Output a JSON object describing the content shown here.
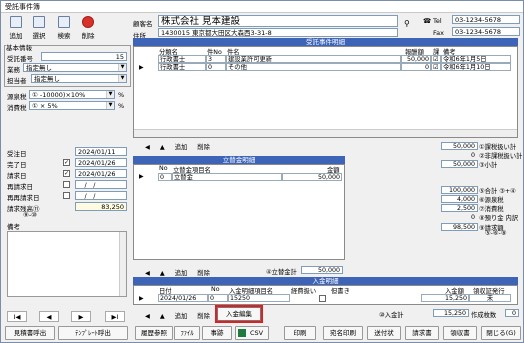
{
  "window": {
    "title": "受託事件簿"
  },
  "toolbar": [
    {
      "label": "追加",
      "icon": "add-icon"
    },
    {
      "label": "選択",
      "icon": "select-icon"
    },
    {
      "label": "検索",
      "icon": "search-icon"
    },
    {
      "label": "削除",
      "icon": "delete-icon"
    }
  ],
  "client": {
    "name_label": "顧客名",
    "name": "株式会社 見本建設",
    "address_label": "住所",
    "address": "1430015 東京都大田区大森西3-31-8",
    "tel_label": "Tel",
    "tel": "03-1234-5678",
    "fax_label": "Fax",
    "fax": "03-1234-5678"
  },
  "basic": {
    "title": "基本情報",
    "jutaku_no_label": "受託番号",
    "jutaku_no": "15",
    "gyomu_label": "業務",
    "gyomu": "指定無し",
    "tanto_label": "担当者",
    "tanto": "指定無し",
    "gensen_label": "源泉税",
    "gensen": "① -10000)×10%",
    "shohi_label": "消費税",
    "shohi": "① × 5%",
    "pct": "%"
  },
  "dates": {
    "juchu_label": "受注日",
    "juchu": "2024/01/11",
    "kanryo_label": "完了日",
    "kanryo": "2024/01/26",
    "seikyu_label": "請求日",
    "seikyu": "2024/01/26",
    "sai1_label": "再請求日",
    "sai1": "__/__/__",
    "sai2_label": "再再請求日",
    "sai2": "__/__/__",
    "zandaka_label": "請求残高⑪",
    "zandaka_sub": "⑨-⑩",
    "zandaka": "83,250",
    "biko_label": "備考"
  },
  "jutaku_detail": {
    "title": "受託事件明細",
    "headers": [
      "分類名",
      "件No",
      "件名",
      "報酬額",
      "課",
      "備考"
    ],
    "rows": [
      {
        "bunrui": "行政書士",
        "no": "3",
        "name": "建設業許可更新",
        "amount": "50,000",
        "kazei": "☑",
        "biko": "令和6年1月5日"
      },
      {
        "bunrui": "行政書士",
        "no": "0",
        "name": "その他",
        "amount": "0",
        "kazei": "☑",
        "biko": "令和6年1月10日"
      }
    ]
  },
  "tatekae": {
    "title": "立替金明細",
    "headers": [
      "No",
      "立替金項目名",
      "金額"
    ],
    "rows": [
      {
        "no": "0",
        "name": "立替金",
        "amount": "50,000"
      }
    ],
    "total_label": "④立替金計",
    "total": "50,000"
  },
  "nyukin": {
    "title": "入金明細",
    "headers": [
      "日付",
      "No",
      "入金明細項目名",
      "経費扱い",
      "但書き",
      "入金額",
      "領収証発行"
    ],
    "rows": [
      {
        "date": "2024/01/26",
        "no": "0",
        "name": "15250",
        "amount": "15,250",
        "receipt": "未"
      }
    ],
    "total_label": "⑩入金計",
    "total": "15,250",
    "extra_label": "作成枚数",
    "extra": "0"
  },
  "summary": [
    {
      "value": "50,000",
      "label": "①課税扱い計"
    },
    {
      "value": "0",
      "label": "②非課税扱い計"
    },
    {
      "value": "50,000",
      "label": "③小計"
    },
    {
      "value": "100,000",
      "label": "⑤合計 ③+④"
    },
    {
      "value": "4,000",
      "label": "⑥源泉税"
    },
    {
      "value": "2,500",
      "label": "⑦消費税"
    },
    {
      "value": "0",
      "label": "⑧預り金 内訳"
    },
    {
      "value": "98,500",
      "label": "⑨請求額",
      "sub": "⑤-⑥-⑧"
    }
  ],
  "nav": {
    "add": "追加",
    "del": "削除",
    "nyukin_input": "入金編集"
  },
  "arrows": [
    "◀",
    "▲"
  ],
  "record_nav": [
    "I◀",
    "◀",
    "▶",
    "▶I"
  ],
  "bottom_buttons": [
    "見積書呼出",
    "ﾃﾝﾌﾟﾚｰﾄ呼出",
    "履歴参照",
    "ﾌｧｲﾙ",
    "事跡",
    "CSV",
    "印刷",
    "宛名印刷",
    "送付状",
    "請求書",
    "領収書",
    "閉じる(G)"
  ],
  "colors": {
    "header": "#3e64b8",
    "highlight": "#e02020"
  }
}
